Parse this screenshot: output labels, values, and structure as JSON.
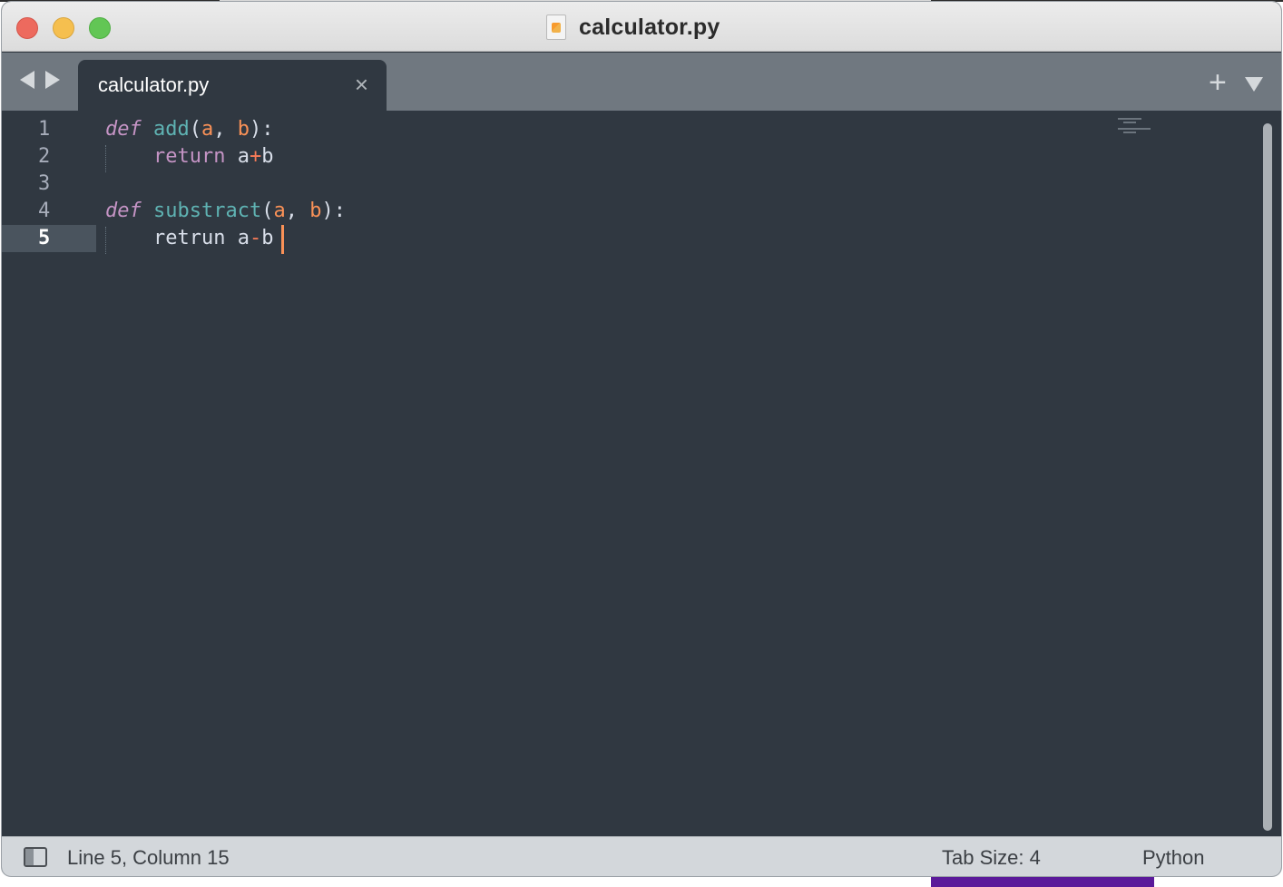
{
  "window": {
    "title": "calculator.py"
  },
  "tabs": [
    {
      "label": "calculator.py",
      "close_glyph": "×",
      "active": true
    }
  ],
  "tabbar": {
    "plus_glyph": "+"
  },
  "editor": {
    "active_line": 5,
    "lines": [
      {
        "number": "1",
        "tokens": [
          {
            "t": "def",
            "c": "kw-def"
          },
          {
            "t": " ",
            "c": "plain"
          },
          {
            "t": "add",
            "c": "fn"
          },
          {
            "t": "(",
            "c": "punc"
          },
          {
            "t": "a",
            "c": "param"
          },
          {
            "t": ", ",
            "c": "punc"
          },
          {
            "t": "b",
            "c": "param"
          },
          {
            "t": "):",
            "c": "punc"
          }
        ]
      },
      {
        "number": "2",
        "tokens": [
          {
            "t": "    ",
            "c": "plain"
          },
          {
            "t": "return",
            "c": "kw-ret"
          },
          {
            "t": " a",
            "c": "plain"
          },
          {
            "t": "+",
            "c": "op"
          },
          {
            "t": "b",
            "c": "plain"
          }
        ]
      },
      {
        "number": "3",
        "tokens": []
      },
      {
        "number": "4",
        "tokens": [
          {
            "t": "def",
            "c": "kw-def"
          },
          {
            "t": " ",
            "c": "plain"
          },
          {
            "t": "substract",
            "c": "fn"
          },
          {
            "t": "(",
            "c": "punc"
          },
          {
            "t": "a",
            "c": "param"
          },
          {
            "t": ", ",
            "c": "punc"
          },
          {
            "t": "b",
            "c": "param"
          },
          {
            "t": "):",
            "c": "punc"
          }
        ]
      },
      {
        "number": "5",
        "tokens": [
          {
            "t": "    ",
            "c": "plain"
          },
          {
            "t": "retrun",
            "c": "plain"
          },
          {
            "t": " a",
            "c": "plain"
          },
          {
            "t": "-",
            "c": "op"
          },
          {
            "t": "b",
            "c": "plain"
          }
        ]
      }
    ]
  },
  "statusbar": {
    "position": "Line 5, Column 15",
    "tab_size": "Tab Size: 4",
    "syntax": "Python"
  },
  "colors": {
    "editor_bg": "#303841",
    "keyword": "#c594c5",
    "function": "#5fb3b3",
    "parameter": "#f99157",
    "caret": "#f99157"
  }
}
